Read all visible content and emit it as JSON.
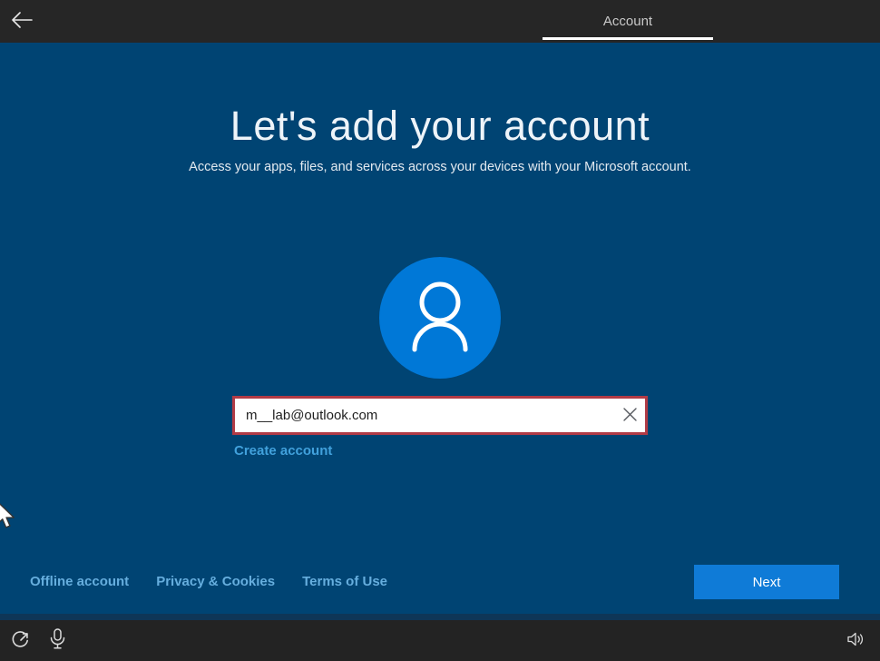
{
  "titlebar": {
    "tab": {
      "label": "Account"
    }
  },
  "main": {
    "title": "Let's add your account",
    "subtitle": "Access your apps, files, and services across your devices with your Microsoft account.",
    "account_form": {
      "email_value": "m__lab@outlook.com",
      "create_account_label": "Create account"
    }
  },
  "footer": {
    "links": [
      {
        "label": "Offline account"
      },
      {
        "label": "Privacy & Cookies"
      },
      {
        "label": "Terms of Use"
      }
    ],
    "next_button_label": "Next"
  },
  "taskbar": {
    "left_icons": [
      "ease-of-access-icon",
      "microphone-icon"
    ],
    "right_icons": [
      "volume-icon"
    ]
  },
  "colors": {
    "background": "#004473",
    "titlebar": "#262626",
    "taskbar": "#232323",
    "avatar_circle": "#0078d7",
    "next_button": "#0f7bd7",
    "input_error_border": "#b13b46",
    "create_account_link": "#41a1dc",
    "footer_link": "#66aede",
    "tab_underline": "#ffffff"
  }
}
